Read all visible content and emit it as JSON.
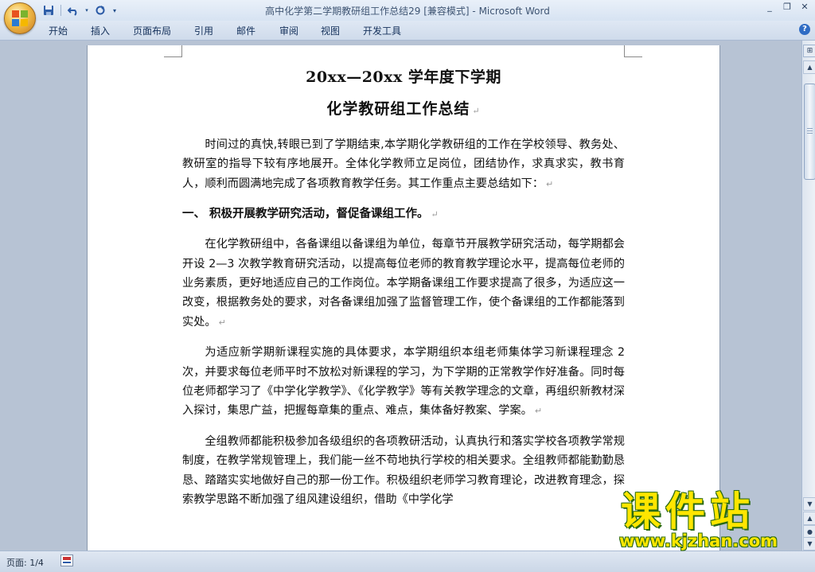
{
  "window": {
    "title": "高中化学第二学期教研组工作总结29 [兼容模式]",
    "title_sep": " - ",
    "app_name": "Microsoft Word",
    "controls": [
      "_",
      "❐",
      "✕"
    ]
  },
  "quick_access": {
    "save_icon": "save-icon",
    "undo_icon": "undo-icon",
    "redo_icon": "redo-icon",
    "customize_icon": "customize-icon"
  },
  "ribbon": {
    "tabs": [
      {
        "label": "开始"
      },
      {
        "label": "插入"
      },
      {
        "label": "页面布局"
      },
      {
        "label": "引用"
      },
      {
        "label": "邮件"
      },
      {
        "label": "审阅"
      },
      {
        "label": "视图"
      },
      {
        "label": "开发工具"
      }
    ],
    "help": "?"
  },
  "document": {
    "title_line1": "20xx—20xx 学年度下学期",
    "title_line2": "化学教研组工作总结",
    "paragraph_mark": "↵",
    "p1": "时间过的真快,转眼已到了学期结束,本学期化学教研组的工作在学校领导、教务处、教研室的指导下较有序地展开。全体化学教师立足岗位，团结协作，求真求实，教书育人，顺利而圆满地完成了各项教育教学任务。其工作重点主要总结如下：",
    "section1": "一、 积极开展教学研究活动，督促备课组工作。",
    "p2": "在化学教研组中，各备课组以备课组为单位，每章节开展教学研究活动，每学期都会开设 2—3 次教学教育研究活动，以提高每位老师的教育教学理论水平，提高每位老师的业务素质，更好地适应自己的工作岗位。本学期备课组工作要求提高了很多，为适应这一改变，根据教务处的要求，对各备课组加强了监督管理工作，使个备课组的工作都能落到实处。",
    "p3": "为适应新学期新课程实施的具体要求，本学期组织本组老师集体学习新课程理念 2 次，并要求每位老师平时不放松对新课程的学习，为下学期的正常教学作好准备。同时每位老师都学习了《中学化学教学》、《化学教学》等有关教学理念的文章，再组织新教材深入探讨，集思广益，把握每章集的重点、难点，集体备好教案、学案。",
    "p4": "全组教师都能积极参加各级组织的各项教研活动，认真执行和落实学校各项教学常规制度，在教学常规管理上，我们能一丝不苟地执行学校的相关要求。全组教师都能勤勤恳恳、踏踏实实地做好自己的那一份工作。积极组织老师学习教育理论，改进教育理念，探索教学思路不断加强了组风建设组织，借助《中学化学"
  },
  "status_bar": {
    "page_info": "页面: 1/4"
  },
  "watermark": {
    "brand": "课件站",
    "url": "www.kjzhan.com"
  }
}
